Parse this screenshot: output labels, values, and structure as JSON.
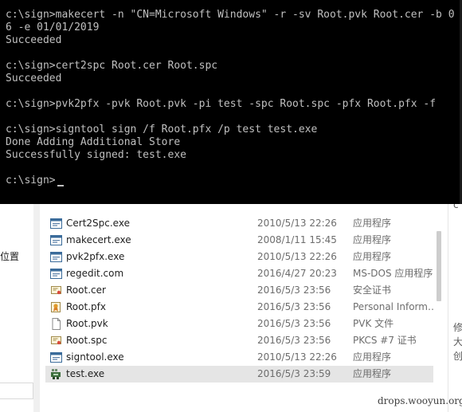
{
  "console": {
    "lines": [
      "c:\\sign>makecert -n \"CN=Microsoft Windows\" -r -sv Root.pvk Root.cer -b 0",
      "6 -e 01/01/2019",
      "Succeeded",
      "",
      "c:\\sign>cert2spc Root.cer Root.spc",
      "Succeeded",
      "",
      "c:\\sign>pvk2pfx -pvk Root.pvk -pi test -spc Root.spc -pfx Root.pfx -f",
      "",
      "c:\\sign>signtool sign /f Root.pfx /p test test.exe",
      "Done Adding Additional Store",
      "Successfully signed: test.exe",
      "",
      "c:\\sign>"
    ]
  },
  "explorer": {
    "nav_label": "位置",
    "details_chars": [
      "c",
      "修",
      "大",
      "创"
    ],
    "files": [
      {
        "name": "Cert2Spc.exe",
        "date": "2010/5/13 22:26",
        "type": "应用程序",
        "icon": "exe-window-icon"
      },
      {
        "name": "makecert.exe",
        "date": "2008/1/11 15:45",
        "type": "应用程序",
        "icon": "exe-window-icon"
      },
      {
        "name": "pvk2pfx.exe",
        "date": "2010/5/13 22:26",
        "type": "应用程序",
        "icon": "exe-window-icon"
      },
      {
        "name": "regedit.com",
        "date": "2016/4/27 20:23",
        "type": "MS-DOS 应用程序",
        "icon": "exe-window-icon"
      },
      {
        "name": "Root.cer",
        "date": "2016/5/3 23:56",
        "type": "安全证书",
        "icon": "certificate-icon"
      },
      {
        "name": "Root.pfx",
        "date": "2016/5/3 23:56",
        "type": "Personal Inform…",
        "icon": "personal-info-cert-icon"
      },
      {
        "name": "Root.pvk",
        "date": "2016/5/3 23:56",
        "type": "PVK 文件",
        "icon": "blank-file-icon"
      },
      {
        "name": "Root.spc",
        "date": "2016/5/3 23:56",
        "type": "PKCS #7 证书",
        "icon": "certificate-icon"
      },
      {
        "name": "signtool.exe",
        "date": "2010/5/13 22:26",
        "type": "应用程序",
        "icon": "exe-window-icon"
      },
      {
        "name": "test.exe",
        "date": "2016/5/3 23:59",
        "type": "应用程序",
        "icon": "signed-exe-icon"
      }
    ]
  },
  "watermark": "drops.wooyun.org",
  "colors": {
    "console_bg": "#000000",
    "console_fg": "#c0c0c0",
    "selected_row": "#e5e5e5",
    "secondary_text": "#6d6d6d"
  }
}
